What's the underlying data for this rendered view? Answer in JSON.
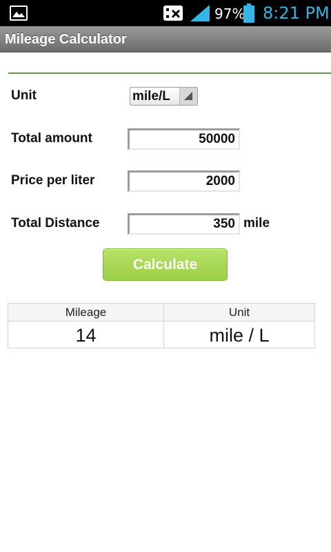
{
  "status_bar": {
    "battery_percent": "97%",
    "time": "8:21 PM",
    "icons": [
      "gallery-icon",
      "media-blocked-icon",
      "signal-icon",
      "battery-icon"
    ],
    "time_color": "#33b5e5"
  },
  "app": {
    "title": "Mileage Calculator"
  },
  "form": {
    "unit_label": "Unit",
    "unit_value": "mile/L",
    "total_amount_label": "Total amount",
    "total_amount_value": "50000",
    "price_per_liter_label": "Price per liter",
    "price_per_liter_value": "2000",
    "total_distance_label": "Total Distance",
    "total_distance_value": "350",
    "distance_unit": "mile",
    "calculate_label": "Calculate",
    "button_color": "#a8d955",
    "divider_color": "#5e9a4d"
  },
  "result": {
    "headers": [
      "Mileage",
      "Unit"
    ],
    "values": [
      "14",
      "mile / L"
    ]
  }
}
